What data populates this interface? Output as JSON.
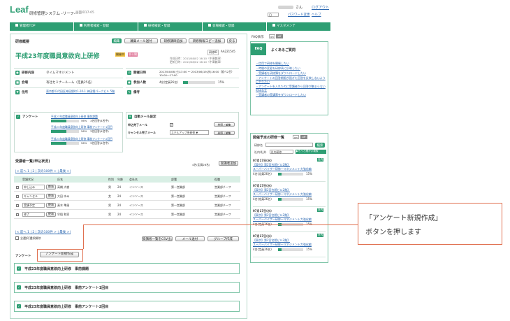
{
  "header": {
    "logo": "Leaf",
    "system_title": "研修管理システム -リーフ-",
    "screen_id": "画面ID17-05",
    "user_suffix": "さん",
    "logout": "ログアウト",
    "lang": "日",
    "pw_change": "パスワード変更",
    "help": "ヘルプ"
  },
  "nav": {
    "tabs": [
      "管理者TOP",
      "利用者検索・登録",
      "研修検索・登録",
      "会場検索・登録",
      "マスタメンテ"
    ]
  },
  "overview": {
    "section_title": "研修概要",
    "edit": "編集",
    "btns": [
      "募集メール送付",
      "研修講師追加",
      "研修情報コピー追加",
      "戻る"
    ],
    "title": "平成23年度職員意欲向上研修",
    "status": "開催中",
    "status2": "非公開",
    "code_label": "研修ID",
    "code": "AA221545",
    "created": "作成日時：2013/08/02 16:10（中澤兼澤）",
    "updated": "更新日時：2013/08/02 16:10（中澤兼澤）",
    "fields": [
      {
        "label": "研修内容",
        "value": "タイムマネジメント"
      },
      {
        "label": "会場",
        "value": "有社セミナールーム（定員25名）"
      },
      {
        "label": "住所",
        "value": "東京都千代田区神田錦町1-10-1 神田錦パークビル 5階"
      }
    ],
    "right_fields": [
      {
        "label": "開催日時",
        "value": "2013/04/06(土)13:00 ～ 2013/06/19(水)16:00（延べ2日）10:00～17:00"
      },
      {
        "label": "参加人数",
        "value": "4名(定員26名)",
        "pct": "15%",
        "fill": 0.15
      },
      {
        "label": "備考",
        "value": ""
      }
    ]
  },
  "survey": {
    "label": "アンケート",
    "items": [
      {
        "title": "平成23年度職員意欲向上研修 事前課題",
        "pct": "56%",
        "count": "3名回答(4名中)",
        "fill": 0.56
      },
      {
        "title": "平成23年度職員意欲向上研修 事前アンケート1回目",
        "pct": "56%",
        "count": "3名回答(4名中)",
        "fill": 0.56
      },
      {
        "title": "平成23年度職員意欲向上研修 事前アンケート2回目",
        "pct": "56%",
        "count": "3名回答(4名中)",
        "fill": 0.56
      }
    ],
    "auto_mail": "自動メール設定",
    "apply_mail": "申込完了メール",
    "apply_edit": "参照 / 編集",
    "cancel_mail": "キャンセル完了メール",
    "cancel_value": "スキルアップ系研修 ▼",
    "cancel_edit": "参照 / 編集"
  },
  "roster": {
    "title": "受講者一覧(申込状況)",
    "count": "4名(定員26名)",
    "add_btn": "受講者追加",
    "pager": "|< 前へ 1 | 2 | 次の100件 > | 最後 >|",
    "columns": [
      "受講状況",
      "",
      "氏名",
      "性別",
      "年齢",
      "会社名",
      "部署",
      "役職"
    ],
    "rows": [
      {
        "status": "申し込み",
        "btn": "更新",
        "name": "高橋 大樹",
        "sex": "男",
        "age": "24",
        "company": "インソース",
        "dept": "第一営業部",
        "role": "営業部チーフ"
      },
      {
        "status": "キャンセル",
        "btn": "更新",
        "name": "大田 ゆみ",
        "sex": "女",
        "age": "24",
        "company": "インソース",
        "dept": "第一営業部",
        "role": "営業部チーフ"
      },
      {
        "status": "受講予定",
        "btn": "更新",
        "name": "真木 準風",
        "sex": "男",
        "age": "24",
        "company": "インソース",
        "dept": "第一営業部",
        "role": "営業部チーフ"
      },
      {
        "status": "修了",
        "btn": "更新",
        "name": "早稲 和家",
        "sex": "男",
        "age": "24",
        "company": "インソース",
        "dept": "第一営業部",
        "role": "営業部チーフ"
      }
    ],
    "select_all": "全選択/選択解除",
    "btn_csv": "受講者一覧をCSV出力",
    "btn_mail": "メール送付",
    "btn_group": "グループ作成"
  },
  "survey_bottom": {
    "label": "アンケート",
    "new_btn": "アンケート新規作成",
    "rows": [
      "平成23年度職員意欲向上研修　事前課題",
      "平成23年度職員意欲向上研修　事前アンケート1回目",
      "平成23年度職員意欲向上研修　事前アンケート2回目"
    ]
  },
  "faq": {
    "display": "FAQ表示",
    "on": "on",
    "off": "off",
    "title": "よくあるご質問",
    "items": [
      "・信用で研修を開催したい",
      "・時間の変更を研修表に反映したい",
      "・受講者を研修簿をダウンロードしたい",
      "・アンケートの回答期限が過ぎた回答を反映しないようにやりたい",
      "・アンケートを入れたのに受講者から回答が集まらないのはなぜ",
      "・受講者の受講票をダウンロードしたい"
    ]
  },
  "upcoming": {
    "title": "開催予定の研修一覧",
    "on": "on",
    "off": "off",
    "name_label": "研修名",
    "search": "検索",
    "org_label": "社内/社外",
    "org_value": "社内研修",
    "narrow": "▶もっと細かい検索",
    "items": [
      {
        "date": "07月17日(水)",
        "place": "【東京】第2宮名館ビル2階】",
        "title": "スーパーバイザー研修～マネジメント力強化編",
        "count": "4名(定員26名)",
        "pct": "15%",
        "fill": 0.15,
        "tag": "社内"
      },
      {
        "date": "07月17日(水)",
        "place": "【東京】第2宮名館ビル2階】",
        "title": "スーパーバイザー研修～マネジメント力強化編",
        "count": "4名(定員26名)",
        "pct": "15%",
        "fill": 0.15,
        "tag": ""
      },
      {
        "date": "07月17日(水)",
        "place": "【東京】第2宮名館ビル2階】",
        "title": "スーパーバイザー研修～マネジメント力強化編",
        "count": "4名(定員26名)",
        "pct": "15%",
        "fill": 0.15,
        "tag": "社内"
      },
      {
        "date": "07月17日(水)",
        "place": "【東京】第2宮名館ビル2階】",
        "title": "スーパーバイザー研修～マネジメント力強化編",
        "count": "4名(定員26名)",
        "pct": "15%",
        "fill": 0.15,
        "tag": "社内"
      }
    ]
  },
  "callout": {
    "line1": "「アンケート新規作成」",
    "line2": "ボタンを押します"
  }
}
